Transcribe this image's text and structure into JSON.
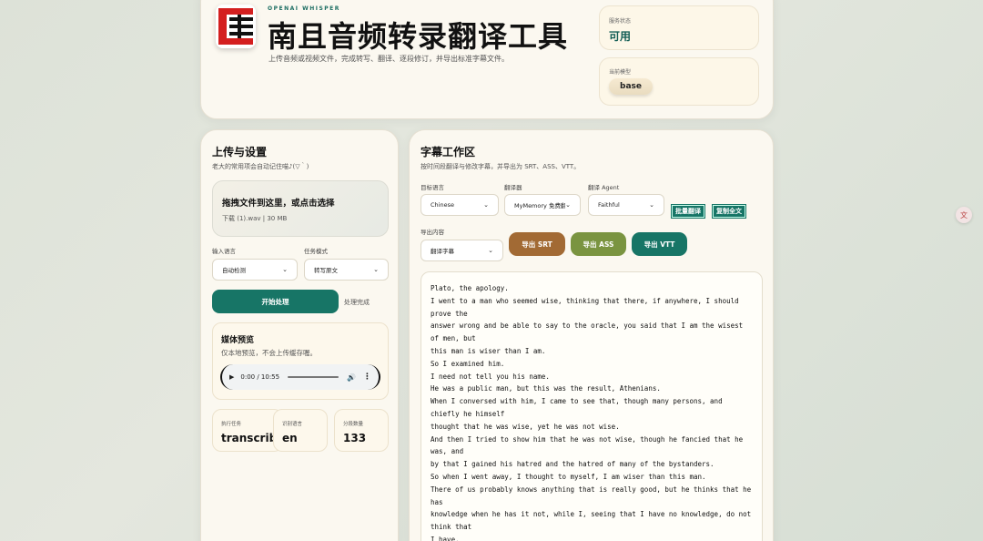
{
  "header": {
    "kicker": "OPENAI WHISPER",
    "title": "南且音频转录翻译工具",
    "subtitle": "上传音频或视频文件，完成转写、翻译、逐段修订，并导出标准字幕文件。",
    "status": {
      "label": "服务状态",
      "value": "可用"
    },
    "model": {
      "label": "当前模型",
      "value": "base"
    }
  },
  "upload": {
    "title": "上传与设置",
    "note": "老大的常用项会自动记住喵♪(▽｀)",
    "drop_title": "拖拽文件到这里，或点击选择",
    "file_info": "下载 (1).wav | 30 MB",
    "input_lang_label": "输入语言",
    "input_lang_value": "自动检测",
    "task_mode_label": "任务模式",
    "task_mode_value": "转写原文",
    "start_button": "开始处理",
    "process_status": "处理完成",
    "media": {
      "title": "媒体预览",
      "note": "仅本地预览，不会上传缓存喔。",
      "time": "0:00 / 10:55"
    },
    "stats": [
      {
        "label": "执行任务",
        "value": "transcribe"
      },
      {
        "label": "识别语言",
        "value": "en"
      },
      {
        "label": "分段数量",
        "value": "133"
      }
    ]
  },
  "workspace": {
    "title": "字幕工作区",
    "note": "按时间段翻译与修改字幕，并导出为 SRT、ASS、VTT。",
    "target_lang_label": "目标语言",
    "target_lang_value": "Chinese",
    "translator_label": "翻译器",
    "translator_value": "MyMemory 免费翻",
    "agent_label": "翻译 Agent",
    "agent_value": "Faithful",
    "batch_translate": "批量翻译",
    "copy_all": "复制全文",
    "export_content_label": "导出内容",
    "export_content_value": "翻译字幕",
    "export_srt": "导出 SRT",
    "export_ass": "导出 ASS",
    "export_vtt": "导出 VTT",
    "colors": {
      "srt": "#a26a34",
      "ass": "#7a9440",
      "vtt": "#177566"
    },
    "transcript": "Plato, the apology.\nI went to a man who seemed wise, thinking that there, if anywhere, I should prove the\nanswer wrong and be able to say to the oracle, you said that I am the wisest of men, but\nthis man is wiser than I am.\nSo I examined him.\nI need not tell you his name.\nHe was a public man, but this was the result, Athenians.\nWhen I conversed with him, I came to see that, though many persons, and chiefly he himself\nthought that he was wise, yet he was not wise.\nAnd then I tried to show him that he was not wise, though he fancied that he was, and\nby that I gained his hatred and the hatred of many of the bystanders.\nSo when I went away, I thought to myself, I am wiser than this man.\nThere of us probably knows anything that is really good, but he thinks that he has\nknowledge when he has it not, while I, seeing that I have no knowledge, do not think that\nI have."
  }
}
